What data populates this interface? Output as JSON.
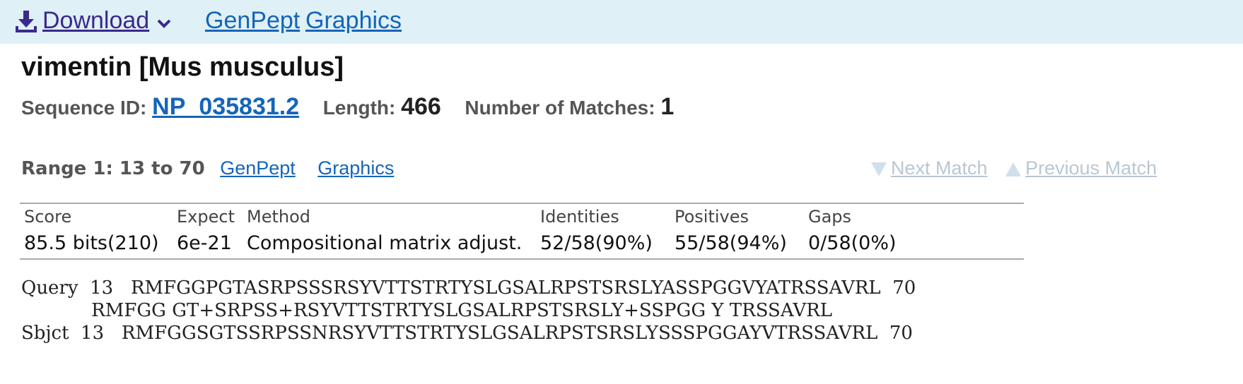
{
  "toolbar": {
    "download_label": "Download",
    "genpept_label": "GenPept",
    "graphics_label": "Graphics"
  },
  "hit": {
    "title": "vimentin [Mus musculus]",
    "sequence_id_label": "Sequence ID:",
    "sequence_id": "NP_035831.2",
    "length_label": "Length:",
    "length": "466",
    "matches_label": "Number of Matches:",
    "matches": "1"
  },
  "range": {
    "label": "Range 1: 13 to 70",
    "genpept_label": "GenPept",
    "graphics_label": "Graphics",
    "next_match_label": "Next Match",
    "previous_match_label": "Previous Match"
  },
  "stats": {
    "score_header": "Score",
    "score_value": "85.5 bits(210)",
    "expect_header": "Expect",
    "expect_value": "6e-21",
    "method_header": "Method",
    "method_value": "Compositional matrix adjust.",
    "identities_header": "Identities",
    "identities_value": "52/58(90%)",
    "positives_header": "Positives",
    "positives_value": "55/58(94%)",
    "gaps_header": "Gaps",
    "gaps_value": "0/58(0%)"
  },
  "alignment": {
    "query_line": "Query  13   RMFGGPGTASRPSSSRSYVTTSTRTYSLGSALRPSTSRSLYASSPGGVYATRSSAVRL  70",
    "middle_line": "            RMFGG GT+SRPSS+RSYVTTSTRTYSLGSALRPSTSRSLY+SSPGG Y TRSSAVRL",
    "sbjct_line": "Sbjct  13   RMFGGSGTSSRPSSNRSYVTTSTRTYSLGSALRPSTSRSLYSSSPGGAYVTRSSAVRL  70"
  },
  "colors": {
    "topbar_bg": "#dff0f7",
    "link": "#1565b8",
    "download": "#3a2a8c",
    "disabled_link": "#b9c7d4"
  },
  "icons": [
    "download-icon",
    "chevron-down-icon",
    "triangle-down-icon",
    "triangle-up-icon"
  ]
}
